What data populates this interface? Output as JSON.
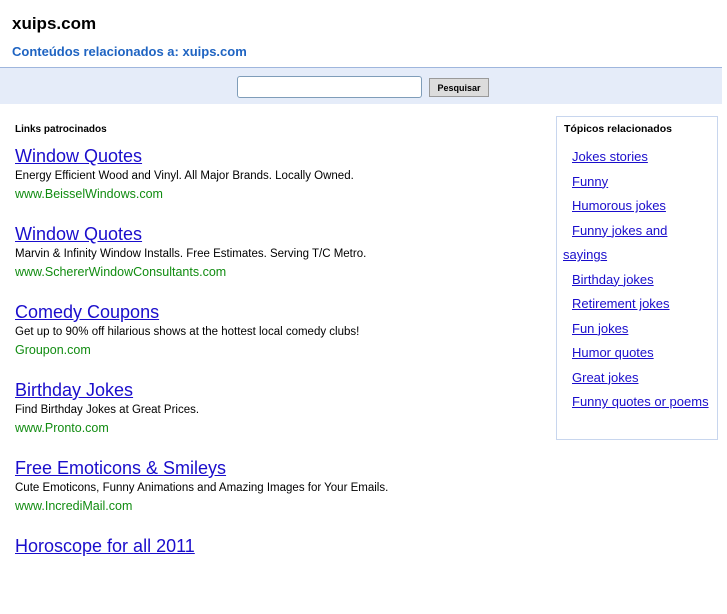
{
  "header": {
    "site_title": "xuips.com",
    "related_heading": "Conteúdos relacionados a: xuips.com"
  },
  "search": {
    "value": "",
    "placeholder": "",
    "button_label": "Pesquisar"
  },
  "ads": {
    "heading": "Links patrocinados",
    "items": [
      {
        "title": "Window Quotes",
        "description": "Energy Efficient Wood and Vinyl. All Major Brands. Locally Owned.",
        "url": "www.BeisselWindows.com"
      },
      {
        "title": "Window Quotes",
        "description": "Marvin & Infinity Window Installs. Free Estimates. Serving T/C Metro.",
        "url": "www.SchererWindowConsultants.com"
      },
      {
        "title": "Comedy Coupons",
        "description": "Get up to 90% off hilarious shows at the hottest local comedy clubs!",
        "url": "Groupon.com"
      },
      {
        "title": "Birthday Jokes",
        "description": "Find Birthday Jokes at Great Prices.",
        "url": "www.Pronto.com"
      },
      {
        "title": "Free Emoticons & Smileys",
        "description": "Cute Emoticons, Funny Animations and Amazing Images for Your Emails.",
        "url": "www.IncrediMail.com"
      },
      {
        "title": "Horoscope for all 2011",
        "description": "",
        "url": ""
      }
    ]
  },
  "topics": {
    "heading": "Tópicos relacionados",
    "items": [
      "Jokes stories",
      "Funny",
      "Humorous jokes",
      "Funny jokes and sayings",
      "Birthday jokes",
      "Retirement jokes",
      "Fun jokes",
      "Humor quotes",
      "Great jokes",
      "Funny quotes or poems"
    ]
  }
}
